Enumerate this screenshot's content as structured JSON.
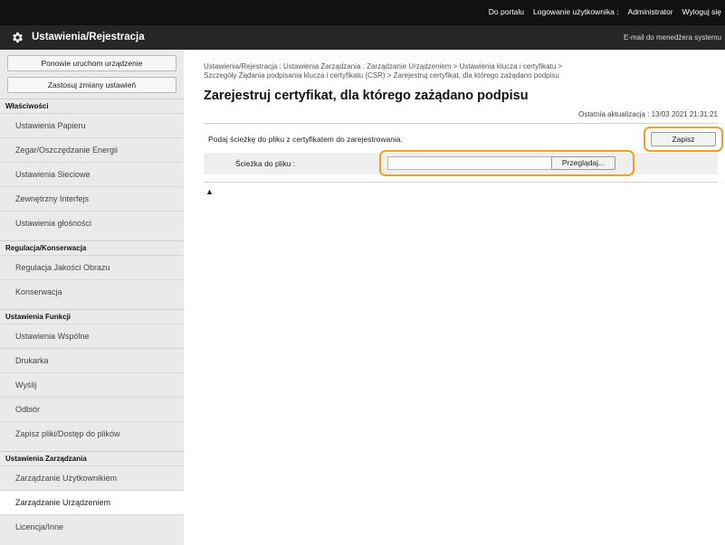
{
  "topbar": {
    "links": [
      "Do portalu",
      "Logowanie użytkownika :",
      "Administrator",
      "Wyloguj się"
    ]
  },
  "titlebar": {
    "title": "Ustawienia/Rejestracja",
    "email": "E-mail do menedżera systemu",
    "icon": "gear-icon"
  },
  "sidebar": {
    "buttons": [
      "Ponowie uruchom urządzenie",
      "Zastosuj zmiany ustawień"
    ],
    "sections": [
      {
        "title": "Właściwości",
        "items": [
          "Ustawienia Papieru",
          "Zegar/Oszczędzanie Energii",
          "Ustawienia Sieciowe",
          "Zewnętrzny Interfejs",
          "Ustawienia głośności"
        ]
      },
      {
        "title": "Regulacja/Konserwacja",
        "items": [
          "Regulacja Jakości Obrazu",
          "Konserwacja"
        ]
      },
      {
        "title": "Ustawienia Funkcji",
        "items": [
          "Ustawienia Wspólne",
          "Drukarka",
          "Wyślij",
          "Odbiór",
          "Zapisz pliki/Dostęp do plików"
        ]
      },
      {
        "title": "Ustawienia Zarządzania",
        "items": [
          "Zarządzanie Użytkownikiem",
          "Zarządzanie Urządzeniem",
          "Licencja/Inne"
        ]
      }
    ],
    "active_item": "Zarządzanie Urządzeniem"
  },
  "main": {
    "breadcrumb_line1": "Ustawienia/Rejestracja : Ustawienia Zarządzania : Zarządzanie Urządzeniem > Ustawienia klucza i certyfikatu >",
    "breadcrumb_line2": "Szczegóły Żądania podpisania klucza i certyfikatu (CSR) > Zarejestruj certyfikat, dla którego zażądano podpisu",
    "title": "Zarejestruj certyfikat, dla którego zażądano podpisu",
    "last_update": "Ostatnia aktualizacja : 13/03 2021 21:31:21",
    "instruction": "Podaj ścieżkę do pliku z certyfikatem do zarejestrowania.",
    "save_label": "Zapisz",
    "path_label": "Ścieżka do pliku :",
    "path_value": "",
    "browse_label": "Przeglądaj...",
    "top_link": "▲",
    "highlight_color": "#f0a020"
  }
}
